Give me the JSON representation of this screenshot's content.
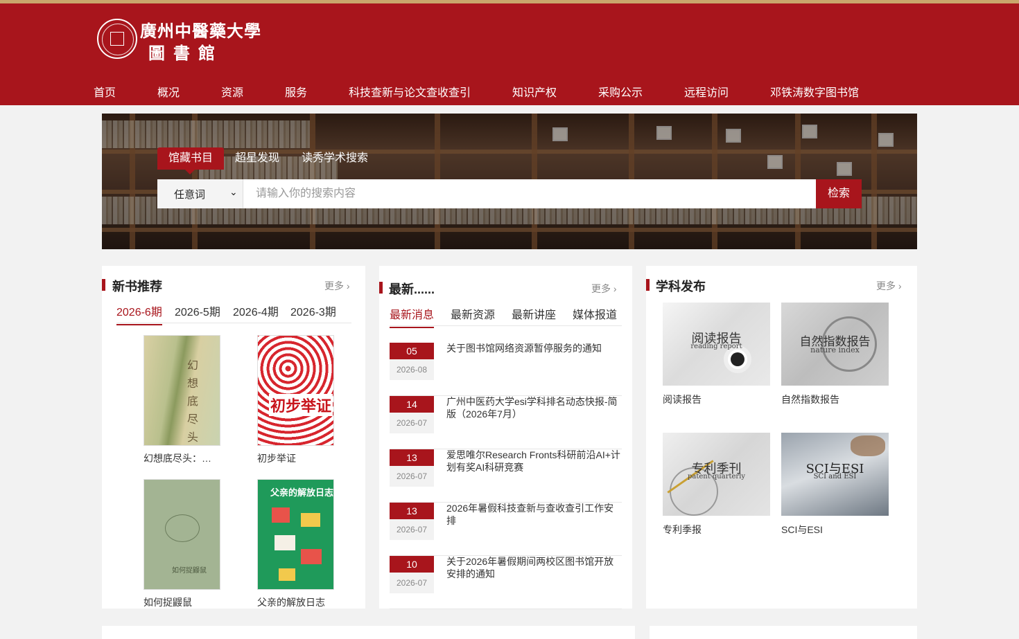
{
  "header": {
    "logo_line1": "廣州中醫藥大學",
    "logo_line2": "圖書館",
    "nav": [
      "首页",
      "概况",
      "资源",
      "服务",
      "科技查新与论文查收查引",
      "知识产权",
      "采购公示",
      "远程访问",
      "邓铁涛数字图书馆"
    ]
  },
  "search": {
    "tabs": [
      "馆藏书目",
      "超星发现",
      "读秀学术搜索"
    ],
    "select_value": "任意词",
    "placeholder": "请输入你的搜索内容",
    "button": "检索"
  },
  "books_panel": {
    "title": "新书推荐",
    "more": "更多",
    "tabs": [
      "2026-6期",
      "2026-5期",
      "2026-4期",
      "2026-3期"
    ],
    "items": [
      {
        "title": "幻想底尽头：…",
        "cover_color": "#c7cfa8"
      },
      {
        "title": "初步举证",
        "cover_color": "#ffffff"
      },
      {
        "title": "如何捉鼹鼠",
        "cover_color": "#9fb18f"
      },
      {
        "title": "父亲的解放日志",
        "cover_color": "#2e8b57"
      }
    ]
  },
  "news_panel": {
    "title": "最新......",
    "more": "更多",
    "tabs": [
      "最新消息",
      "最新资源",
      "最新讲座",
      "媒体报道"
    ],
    "items": [
      {
        "day": "05",
        "ym": "2026-08",
        "title": "关于图书馆网络资源暂停服务的通知"
      },
      {
        "day": "14",
        "ym": "2026-07",
        "title": "广州中医药大学esi学科排名动态快报-简版（2026年7月）"
      },
      {
        "day": "13",
        "ym": "2026-07",
        "title": "爱思唯尔Research Fronts科研前沿AI+计划有奖AI科研竞赛"
      },
      {
        "day": "13",
        "ym": "2026-07",
        "title": "2026年暑假科技查新与查收查引工作安排"
      },
      {
        "day": "10",
        "ym": "2026-07",
        "title": "关于2026年暑假期间两校区图书馆开放安排的通知"
      }
    ]
  },
  "subject_panel": {
    "title": "学科发布",
    "more": "更多",
    "items": [
      {
        "label": "阅读报告",
        "img_cn": "阅读报告",
        "img_en": "reading report"
      },
      {
        "label": "自然指数报告",
        "img_cn": "自然指数报告",
        "img_en": "nature index"
      },
      {
        "label": "专利季报",
        "img_cn": "专利季刊",
        "img_en": "patent quarterly"
      },
      {
        "label": "SCI与ESI",
        "img_cn": "SCI与ESI",
        "img_en": "SCI and ESI"
      }
    ]
  },
  "colors": {
    "brand": "#a8151c",
    "gold": "#c9a66b"
  }
}
